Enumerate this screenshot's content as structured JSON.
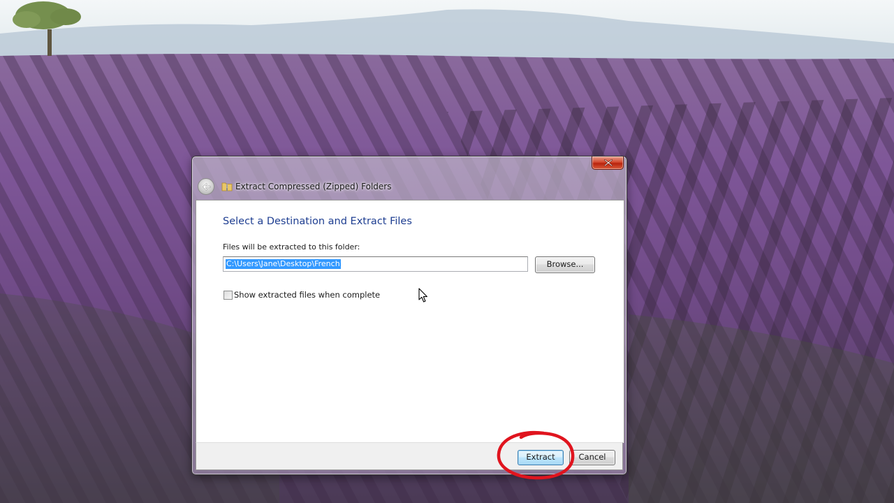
{
  "dialog": {
    "title": "Extract Compressed (Zipped) Folders",
    "heading": "Select a Destination and Extract Files",
    "destination_label": "Files will be extracted to this folder:",
    "destination_value": "C:\\Users\\Jane\\Desktop\\French",
    "browse_label": "Browse...",
    "show_files_label": "Show extracted files when complete",
    "show_files_checked": false,
    "extract_label": "Extract",
    "cancel_label": "Cancel"
  },
  "icons": {
    "close": "close-icon",
    "back": "back-arrow-icon",
    "title_icon": "zip-folder-icon",
    "cursor": "mouse-cursor-icon"
  },
  "colors": {
    "heading": "#1e3e91",
    "selection": "#3399ff",
    "annotation": "#e0141e",
    "close_button": "#c8321a"
  }
}
